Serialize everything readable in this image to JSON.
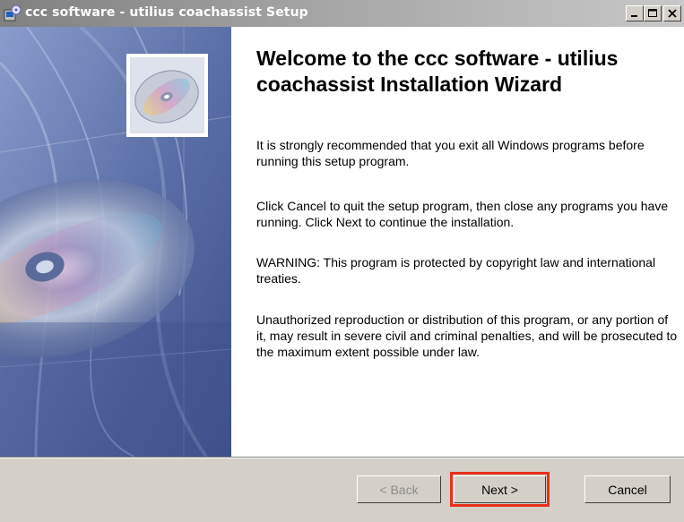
{
  "window": {
    "title": "ccc software - utilius coachassist Setup",
    "icon": "setup-icon"
  },
  "titlebar_buttons": [
    "minimize-icon",
    "maximize-icon",
    "close-icon"
  ],
  "content": {
    "heading": "Welcome to the ccc software - utilius coachassist Installation Wizard",
    "paragraphs": [
      "It is strongly recommended that you exit all Windows programs before running this setup program.",
      "Click Cancel to quit the setup program, then close any programs you have running.  Click Next to continue the installation.",
      "WARNING: This program is protected by copyright law and international treaties.",
      "Unauthorized reproduction or distribution of this program, or any portion of it, may result in severe civil and criminal penalties, and will be prosecuted to the maximum extent possible under law."
    ]
  },
  "buttons": {
    "back": "< Back",
    "next": "Next >",
    "cancel": "Cancel"
  },
  "colors": {
    "highlight": "#e8301c",
    "sidebar": "#6b7fb5"
  }
}
